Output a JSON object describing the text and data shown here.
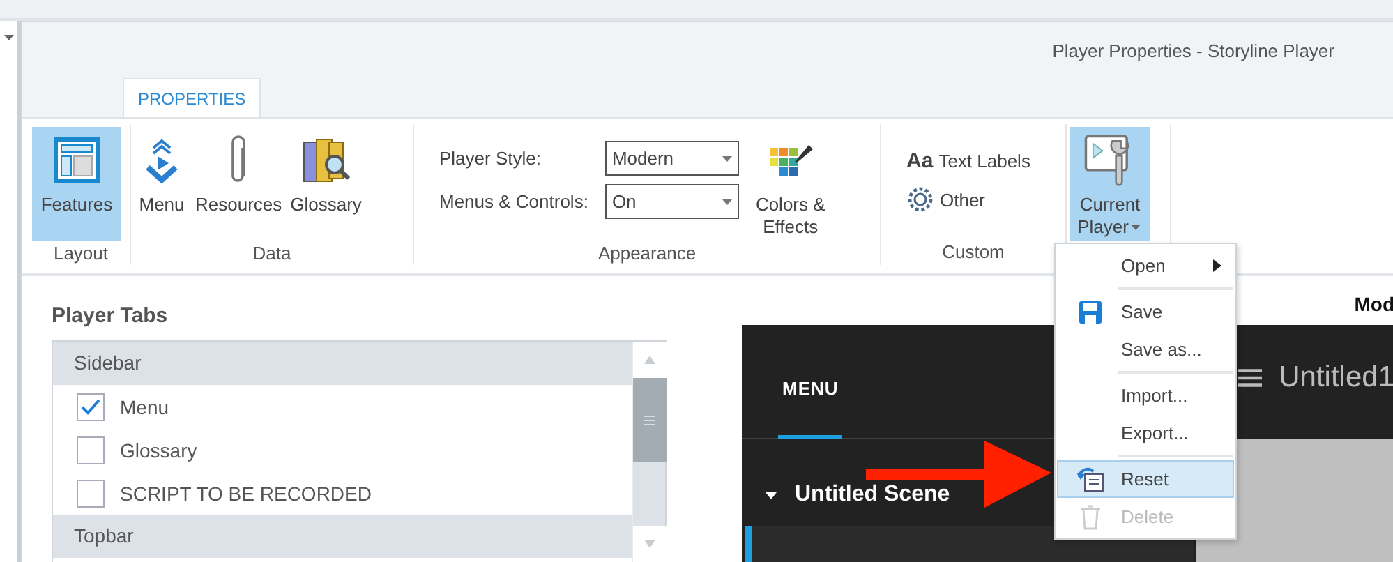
{
  "window": {
    "title": "Player Properties - Storyline Player"
  },
  "ribbon": {
    "tabs": [
      {
        "label": "PROPERTIES",
        "selected": true
      }
    ],
    "groups": [
      {
        "label": "Layout",
        "controls": [
          {
            "kind": "large",
            "label": "Features",
            "selected": true
          }
        ]
      },
      {
        "label": "Data",
        "controls": [
          {
            "kind": "large",
            "label": "Menu",
            "selected": false
          },
          {
            "kind": "large",
            "label": "Resources",
            "selected": false
          },
          {
            "kind": "large",
            "label": "Glossary",
            "selected": false
          }
        ]
      },
      {
        "label": "Appearance",
        "controls": [
          {
            "kind": "dropdowns",
            "fields": [
              {
                "label": "Player Style:",
                "value": "Modern"
              },
              {
                "label": "Menus & Controls:",
                "value": "On"
              }
            ]
          },
          {
            "kind": "large",
            "label": "Colors &\nEffects",
            "selected": false
          }
        ]
      },
      {
        "label": "Custom",
        "controls": [
          {
            "kind": "small",
            "glyph": "Aa",
            "label": "Text Labels"
          },
          {
            "kind": "small",
            "label": "Other"
          }
        ]
      },
      {
        "controls": [
          {
            "kind": "split",
            "label": "Current Player",
            "expanded": true
          }
        ]
      }
    ]
  },
  "player_tabs": {
    "title": "Player Tabs",
    "sections": [
      {
        "title": "Sidebar",
        "items": [
          {
            "label": "Menu",
            "checked": true
          },
          {
            "label": "Glossary",
            "checked": false
          },
          {
            "label": "SCRIPT TO BE RECORDED",
            "checked": false
          }
        ]
      },
      {
        "title": "Topbar"
      }
    ]
  },
  "preview": {
    "heading": "Mod",
    "menu_tab": "MENU",
    "course_title": "Untitled1",
    "scene": {
      "label": "Untitled Scene",
      "expanded": true
    }
  },
  "context_menu": {
    "items": [
      {
        "kind": "item",
        "label": "Open",
        "submenu": true,
        "selected": false,
        "disabled": false
      },
      {
        "kind": "separator"
      },
      {
        "kind": "item",
        "label": "Save",
        "selected": false,
        "disabled": false
      },
      {
        "kind": "item",
        "label": "Save as...",
        "selected": false,
        "disabled": false
      },
      {
        "kind": "separator"
      },
      {
        "kind": "item",
        "label": "Import...",
        "selected": false,
        "disabled": false
      },
      {
        "kind": "item",
        "label": "Export...",
        "selected": false,
        "disabled": false
      },
      {
        "kind": "separator"
      },
      {
        "kind": "item",
        "label": "Reset",
        "selected": true,
        "disabled": false
      },
      {
        "kind": "item",
        "label": "Delete",
        "selected": false,
        "disabled": true
      }
    ]
  }
}
